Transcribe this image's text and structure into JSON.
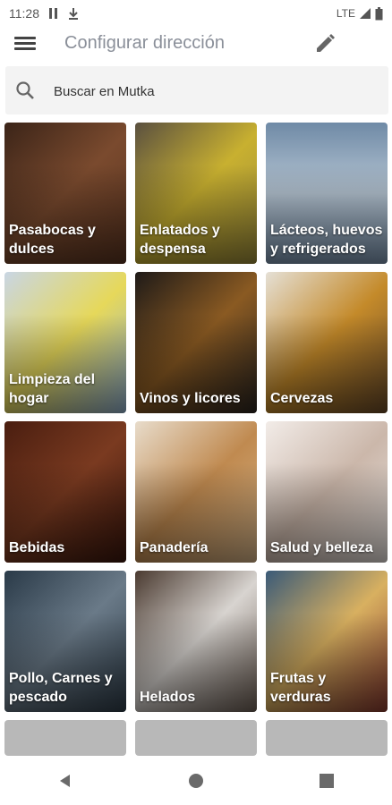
{
  "status_bar": {
    "time": "11:28",
    "network": "LTE"
  },
  "app_bar": {
    "title": "Configurar dirección",
    "menu_icon": "hamburger-menu-icon",
    "edit_icon": "pencil-icon"
  },
  "search": {
    "placeholder": "Buscar en Mutka"
  },
  "categories": [
    {
      "label": "Pasabocas y dulces",
      "color": "#6b3e26"
    },
    {
      "label": "Enlatados y despensa",
      "color": "#a08a2c"
    },
    {
      "label": "Lácteos, huevos y refrigerados",
      "color": "#8fa6bb"
    },
    {
      "label": "Limpieza del hogar",
      "color": "#9fb0c4"
    },
    {
      "label": "Vinos y licores",
      "color": "#2b2520"
    },
    {
      "label": "Cervezas",
      "color": "#b37a2e"
    },
    {
      "label": "Bebidas",
      "color": "#5a2a18"
    },
    {
      "label": "Panadería",
      "color": "#c79a66"
    },
    {
      "label": "Salud y belleza",
      "color": "#dcd2cc"
    },
    {
      "label": "Pollo, Carnes y pescado",
      "color": "#3a4a58"
    },
    {
      "label": "Helados",
      "color": "#6d5f55"
    },
    {
      "label": "Frutas y verduras",
      "color": "#4a6a86"
    }
  ],
  "colors": {
    "accent": "#8a8f99",
    "placeholder_tile": "#b8b8b8"
  }
}
